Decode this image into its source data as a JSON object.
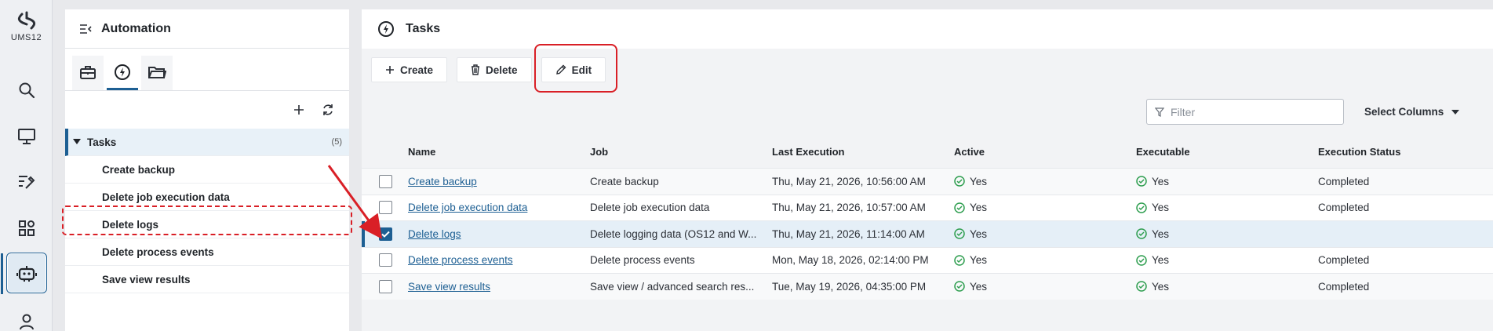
{
  "app": {
    "logo_text": "UMS12"
  },
  "rail": {
    "items": [
      {
        "icon": "search-icon"
      },
      {
        "icon": "monitor-icon"
      },
      {
        "icon": "tools-icon"
      },
      {
        "icon": "apps-grid-icon"
      },
      {
        "icon": "robot-icon",
        "active": true
      },
      {
        "icon": "user-icon"
      }
    ]
  },
  "tree": {
    "title": "Automation",
    "tabs": [
      "briefcase-icon",
      "lightning-icon",
      "folder-icon"
    ],
    "root": {
      "label": "Tasks",
      "count": "(5)"
    },
    "children": [
      "Create backup",
      "Delete job execution data",
      "Delete logs",
      "Delete process events",
      "Save view results"
    ]
  },
  "main": {
    "title": "Tasks",
    "toolbar": {
      "create": "Create",
      "delete": "Delete",
      "edit": "Edit"
    },
    "filter": {
      "placeholder": "Filter"
    },
    "select_columns": "Select Columns",
    "columns": [
      "Name",
      "Job",
      "Last Execution",
      "Active",
      "Executable",
      "Execution Status"
    ],
    "rows": [
      {
        "name": "Create backup",
        "job": "Create backup",
        "last": "Thu, May 21, 2026, 10:56:00 AM",
        "active": "Yes",
        "exec": "Yes",
        "status": "Completed",
        "checked": false
      },
      {
        "name": "Delete job execution data",
        "job": "Delete job execution data",
        "last": "Thu, May 21, 2026, 10:57:00 AM",
        "active": "Yes",
        "exec": "Yes",
        "status": "Completed",
        "checked": false
      },
      {
        "name": "Delete logs",
        "job": "Delete logging data (OS12 and W...",
        "last": "Thu, May 21, 2026, 11:14:00 AM",
        "active": "Yes",
        "exec": "Yes",
        "status": "",
        "checked": true
      },
      {
        "name": "Delete process events",
        "job": "Delete process events",
        "last": "Mon, May 18, 2026, 02:14:00 PM",
        "active": "Yes",
        "exec": "Yes",
        "status": "Completed",
        "checked": false
      },
      {
        "name": "Save view results",
        "job": "Save view / advanced search res...",
        "last": "Tue, May 19, 2026, 04:35:00 PM",
        "active": "Yes",
        "exec": "Yes",
        "status": "Completed",
        "checked": false
      }
    ]
  },
  "colors": {
    "accent": "#1d5f93",
    "annotation": "#d91f26",
    "success": "#2e9e4f"
  }
}
